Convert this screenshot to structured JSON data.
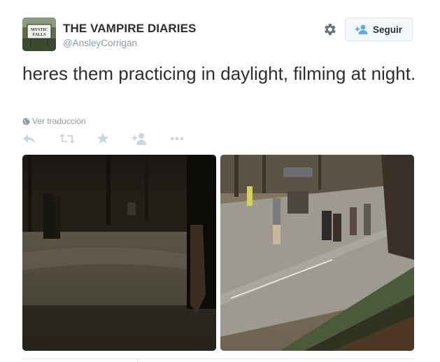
{
  "user": {
    "display_name": "THE VAMPIRE DIARIES",
    "handle": "@AnsleyCorrigan",
    "avatar_sign_text": "MYSTIC FALLS"
  },
  "follow_button": {
    "label": "Seguir"
  },
  "tweet": {
    "text": "heres them practicing in daylight, filming at night.",
    "translate_label": "Ver traducción"
  },
  "actions": [
    "reply-icon",
    "retweet-icon",
    "favorite-icon",
    "follow-icon",
    "more-icon"
  ],
  "media": [
    {
      "name": "night-street-photo"
    },
    {
      "name": "daylight-street-photo"
    }
  ],
  "colors": {
    "text": "#292f33",
    "muted": "#8899a6",
    "action_icons": "#ccd6dd",
    "border": "#e1e8ed",
    "button_bg": "#f5f8fa",
    "follow_icon": "#55acee"
  }
}
